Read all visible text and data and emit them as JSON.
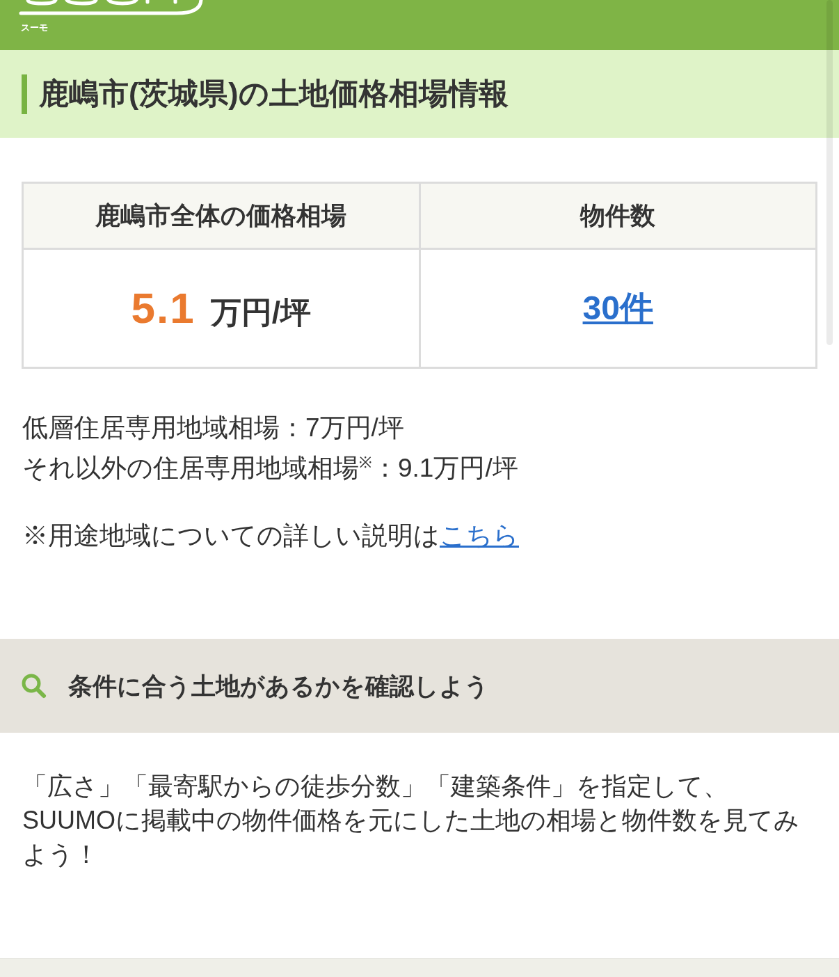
{
  "header": {
    "logo_caption": "スーモ"
  },
  "page_title": "鹿嶋市(茨城県)の土地価格相場情報",
  "summary_table": {
    "columns": [
      "鹿嶋市全体の価格相場",
      "物件数"
    ],
    "price_value": "5.1",
    "price_unit": "万円/坪",
    "listing_count": "30件"
  },
  "zone_prices": [
    "低層住居専用地域相場：7万円/坪",
    "それ以外の住居専用地域相場$^{※}$：9.1万円/坪"
  ],
  "zone_note": {
    "text": "※用途地域についての詳しい説明は",
    "link": "こちら"
  },
  "search_section": {
    "title": "条件に合う土地があるかを確認しよう",
    "description": [
      "「広さ」「最寄駅からの徒歩分数」「建築条件」を指定して、",
      "SUUMOに掲載中の物件価格を元にした土地の相場と物件数を見てみよう！"
    ]
  }
}
